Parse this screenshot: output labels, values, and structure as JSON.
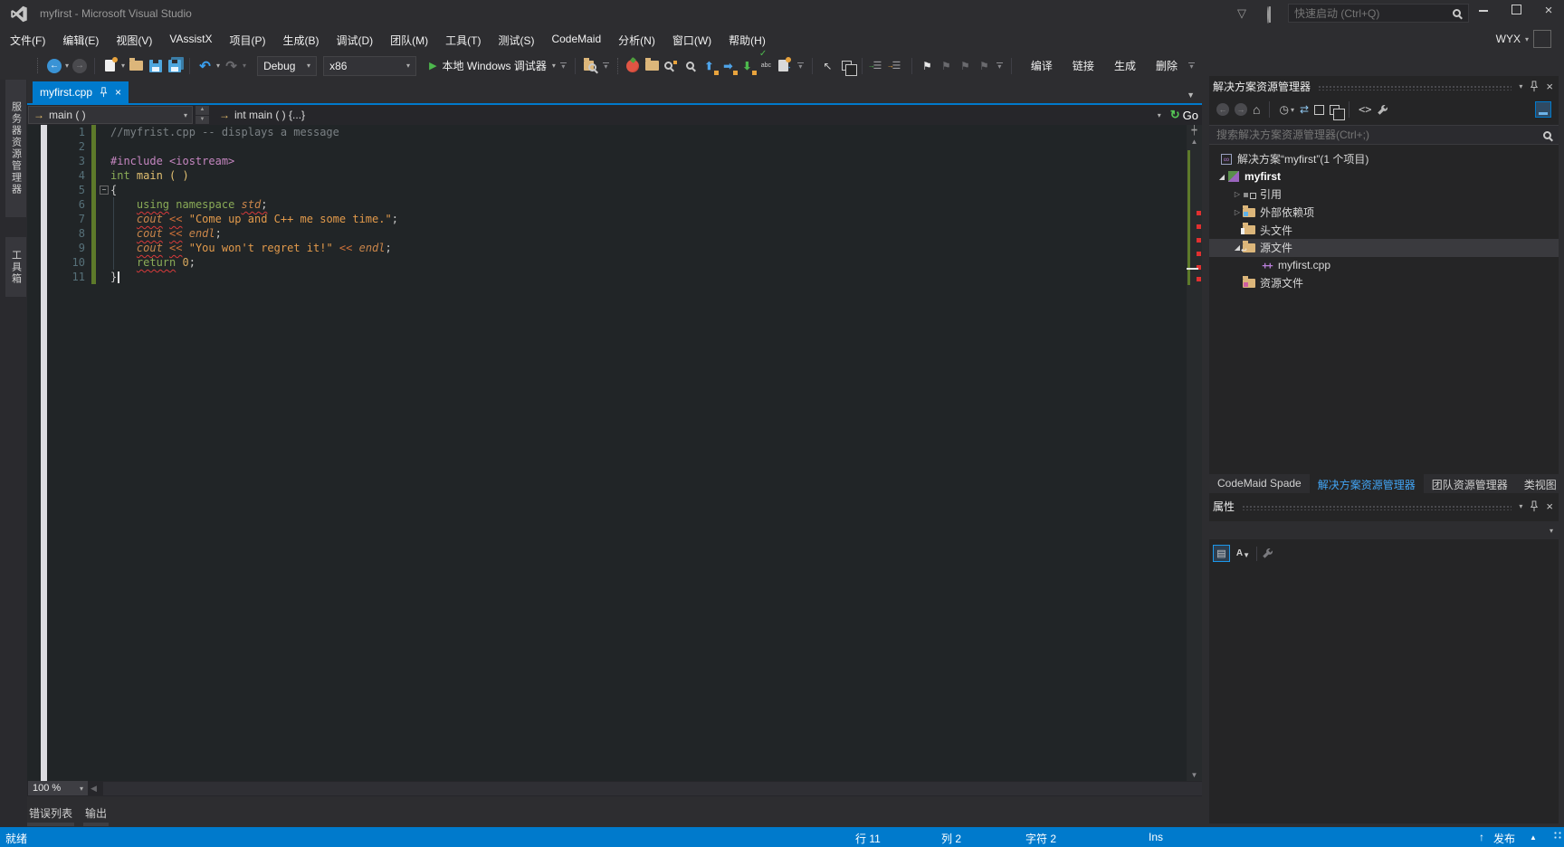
{
  "titlebar": {
    "title": "myfirst - Microsoft Visual Studio",
    "quick_launch_placeholder": "快速启动 (Ctrl+Q)",
    "user": "WYX"
  },
  "menu": {
    "items": [
      "文件(F)",
      "编辑(E)",
      "视图(V)",
      "VAssistX",
      "项目(P)",
      "生成(B)",
      "调试(D)",
      "团队(M)",
      "工具(T)",
      "测试(S)",
      "CodeMaid",
      "分析(N)",
      "窗口(W)",
      "帮助(H)"
    ]
  },
  "toolbar": {
    "configuration": "Debug",
    "platform": "x86",
    "start_label": "本地 Windows 调试器",
    "text_buttons": [
      "编译",
      "链接",
      "生成",
      "删除"
    ]
  },
  "left_rail": {
    "tabs": [
      "服务器资源管理器",
      "工具箱"
    ]
  },
  "editor": {
    "tab": {
      "label": "myfirst.cpp"
    },
    "navbar": {
      "scope": "main ( )",
      "member": "int main ( ) {...}",
      "go": "Go"
    },
    "zoom": "100 %",
    "lines": [
      {
        "n": "1",
        "tokens": [
          {
            "t": "//myfrist.cpp -- displays a message",
            "c": "cm"
          }
        ]
      },
      {
        "n": "2",
        "tokens": []
      },
      {
        "n": "3",
        "tokens": [
          {
            "t": "#include ",
            "c": "pp"
          },
          {
            "t": "<iostream>",
            "c": "pp"
          }
        ]
      },
      {
        "n": "4",
        "tokens": [
          {
            "t": "int ",
            "c": "kw"
          },
          {
            "t": "main ( )",
            "c": "fn"
          }
        ]
      },
      {
        "n": "5",
        "fold": true,
        "tokens": [
          {
            "t": "{",
            "c": "pl"
          }
        ]
      },
      {
        "n": "6",
        "tokens": [
          {
            "t": "    ",
            "c": "pl"
          },
          {
            "t": "using",
            "c": "kw sq"
          },
          {
            "t": " ",
            "c": "pl"
          },
          {
            "t": "namespace ",
            "c": "kw"
          },
          {
            "t": "std",
            "c": "id sq"
          },
          {
            "t": ";",
            "c": "pl sq"
          }
        ]
      },
      {
        "n": "7",
        "tokens": [
          {
            "t": "    ",
            "c": "pl"
          },
          {
            "t": "cout",
            "c": "id sq"
          },
          {
            "t": " ",
            "c": "pl"
          },
          {
            "t": "<<",
            "c": "op sq"
          },
          {
            "t": " ",
            "c": "pl"
          },
          {
            "t": "\"Come up and C++ me some time.\"",
            "c": "st"
          },
          {
            "t": ";",
            "c": "pl"
          }
        ]
      },
      {
        "n": "8",
        "tokens": [
          {
            "t": "    ",
            "c": "pl"
          },
          {
            "t": "cout",
            "c": "id sq"
          },
          {
            "t": " ",
            "c": "pl"
          },
          {
            "t": "<<",
            "c": "op sq"
          },
          {
            "t": " ",
            "c": "pl"
          },
          {
            "t": "endl",
            "c": "id"
          },
          {
            "t": ";",
            "c": "pl"
          }
        ]
      },
      {
        "n": "9",
        "tokens": [
          {
            "t": "    ",
            "c": "pl"
          },
          {
            "t": "cout",
            "c": "id sq"
          },
          {
            "t": " ",
            "c": "pl"
          },
          {
            "t": "<<",
            "c": "op sq"
          },
          {
            "t": " ",
            "c": "pl"
          },
          {
            "t": "\"You won't regret it!\"",
            "c": "st"
          },
          {
            "t": " ",
            "c": "pl"
          },
          {
            "t": "<<",
            "c": "op"
          },
          {
            "t": " ",
            "c": "pl"
          },
          {
            "t": "endl",
            "c": "id"
          },
          {
            "t": ";",
            "c": "pl"
          }
        ]
      },
      {
        "n": "10",
        "tokens": [
          {
            "t": "    ",
            "c": "pl"
          },
          {
            "t": "return",
            "c": "kw sq"
          },
          {
            "t": " ",
            "c": "pl"
          },
          {
            "t": "0",
            "c": "nm"
          },
          {
            "t": ";",
            "c": "pl"
          }
        ]
      },
      {
        "n": "11",
        "caret": true,
        "tokens": [
          {
            "t": "}",
            "c": "pl"
          }
        ]
      }
    ]
  },
  "solution_explorer": {
    "title": "解决方案资源管理器",
    "search_placeholder": "搜索解决方案资源管理器(Ctrl+;)",
    "tree": [
      {
        "label": "解决方案“myfirst”(1 个项目)",
        "icon": "solution",
        "level": 0,
        "expander": "none"
      },
      {
        "label": "myfirst",
        "icon": "project",
        "level": 1,
        "expander": "expanded",
        "bold": true
      },
      {
        "label": "引用",
        "icon": "references",
        "level": 2,
        "expander": "collapsed"
      },
      {
        "label": "外部依赖项",
        "icon": "folder-deps",
        "level": 2,
        "expander": "collapsed"
      },
      {
        "label": "头文件",
        "icon": "folder-header",
        "level": 2,
        "expander": "none"
      },
      {
        "label": "源文件",
        "icon": "folder-source",
        "level": 2,
        "expander": "expanded",
        "selected": true
      },
      {
        "label": "myfirst.cpp",
        "icon": "cpp-file",
        "level": 3,
        "expander": "none"
      },
      {
        "label": "资源文件",
        "icon": "folder-resource",
        "level": 2,
        "expander": "none"
      }
    ],
    "panel_tabs": [
      {
        "label": "CodeMaid Spade",
        "active": false
      },
      {
        "label": "解决方案资源管理器",
        "active": true
      },
      {
        "label": "团队资源管理器",
        "active": false
      },
      {
        "label": "类视图",
        "active": false
      }
    ]
  },
  "properties": {
    "title": "属性"
  },
  "output_tabs": [
    "错误列表",
    "输出"
  ],
  "statusbar": {
    "ready": "就绪",
    "line": "行 11",
    "column": "列 2",
    "char": "字符 2",
    "mode": "Ins",
    "publish": "发布"
  },
  "colors": {
    "accent": "#007acc",
    "editor_background": "#212527",
    "shell_background": "#2d2d30",
    "change_bar": "#5d7a2a",
    "squiggle": "#d83a3a",
    "active_tab_text": "#42a5f5"
  }
}
